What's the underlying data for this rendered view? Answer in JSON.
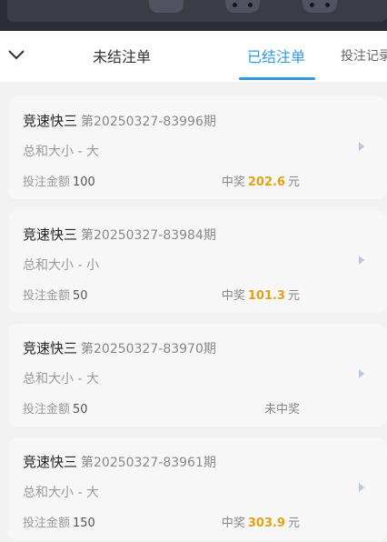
{
  "tabs": {
    "unsettled": "未结注单",
    "settled": "已结注单",
    "records": "投注记录"
  },
  "labels": {
    "amount": "投注金额",
    "win": "中奖",
    "currency": "元",
    "lose": "未中奖"
  },
  "bets": [
    {
      "game": "竞速快三",
      "period": "第20250327-83996期",
      "play": "总和大小 - 大",
      "amount": "100",
      "won": true,
      "payout": "202.6"
    },
    {
      "game": "竞速快三",
      "period": "第20250327-83984期",
      "play": "总和大小 - 小",
      "amount": "50",
      "won": true,
      "payout": "101.3"
    },
    {
      "game": "竞速快三",
      "period": "第20250327-83970期",
      "play": "总和大小 - 大",
      "amount": "50",
      "won": false,
      "payout": ""
    },
    {
      "game": "竞速快三",
      "period": "第20250327-83961期",
      "play": "总和大小 - 大",
      "amount": "150",
      "won": true,
      "payout": "303.9"
    }
  ],
  "colors": {
    "accent": "#2f9ae0",
    "win": "#e0a21a"
  }
}
